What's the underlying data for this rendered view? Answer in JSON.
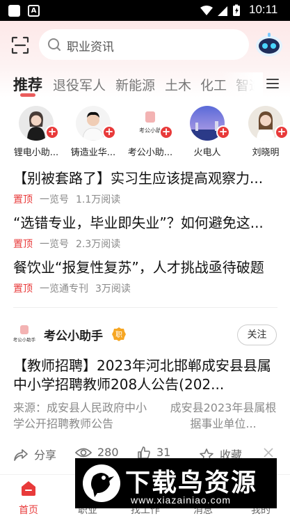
{
  "status_bar": {
    "time": "10:11",
    "notif_letter": "A"
  },
  "search": {
    "placeholder": "职业资讯"
  },
  "tabs": [
    {
      "label": "推荐",
      "active": true
    },
    {
      "label": "退役军人"
    },
    {
      "label": "新能源"
    },
    {
      "label": "土木"
    },
    {
      "label": "化工"
    },
    {
      "label": "智造"
    }
  ],
  "creators": [
    {
      "name": "锂电小助..."
    },
    {
      "name": "铸造业华..."
    },
    {
      "name": "考公小助...",
      "logo_text": "考公小助"
    },
    {
      "name": "火电人"
    },
    {
      "name": "刘晓明"
    }
  ],
  "pinned": [
    {
      "title": "【别被套路了】实习生应该提高观察力...",
      "tag": "置顶",
      "source": "一览号",
      "reads": "1.1万阅读"
    },
    {
      "title": "“选错专业，毕业即失业”？如何避免这...",
      "tag": "置顶",
      "source": "一览号",
      "reads": "2.3万阅读"
    },
    {
      "title": "餐饮业“报复性复苏”，人才挑战亟待破题",
      "tag": "置顶",
      "source": "一览通专刊",
      "reads": "3万阅读"
    }
  ],
  "card": {
    "author": "考公小助手",
    "logo_text": "考公小助手",
    "badge": "职",
    "follow_label": "关注",
    "title": "【教师招聘】2023年河北邯郸成安县县属中小学招聘教师208人公告(202...",
    "sub_left": "来源：成安县人民政府中小学公开招聘教师公告",
    "sub_right": "成安县2023年县属根据事业单位...",
    "actions": {
      "share": "分享",
      "views": "280",
      "likes": "31",
      "fav": "收藏"
    }
  },
  "bottom_nav": [
    {
      "label": "首页",
      "active": true
    },
    {
      "label": "职业"
    },
    {
      "label": "找工作"
    },
    {
      "label": "消息"
    },
    {
      "label": "我的"
    }
  ],
  "watermark": {
    "title": "下载鸟资源",
    "url": "www.xiazainiao.com"
  },
  "colors": {
    "accent": "#e83a3a",
    "header_bg": "#fde8e8"
  }
}
